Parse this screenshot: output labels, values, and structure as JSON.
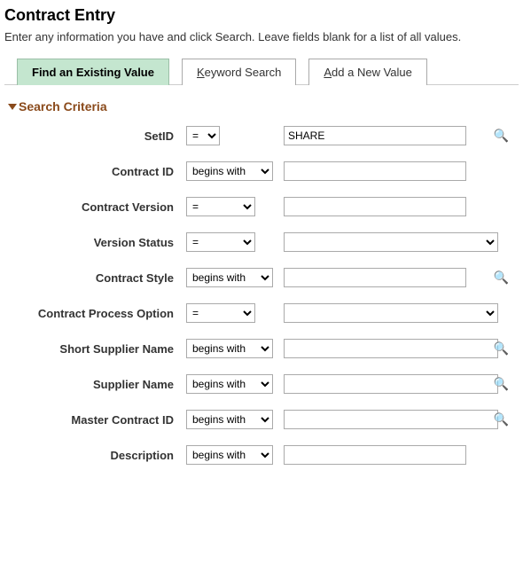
{
  "page": {
    "title": "Contract Entry",
    "subtitle": "Enter any information you have and click Search. Leave fields blank for a list of all values."
  },
  "tabs": {
    "find": "Find an Existing Value",
    "keyword_pre": "K",
    "keyword_rest": "eyword Search",
    "add_pre": "A",
    "add_rest": "dd a New Value"
  },
  "section": {
    "search_criteria": "Search Criteria"
  },
  "ops": {
    "eq": "=",
    "bw": "begins with"
  },
  "rows": {
    "setid": {
      "label": "SetID",
      "value": "SHARE"
    },
    "cid": {
      "label": "Contract ID",
      "value": ""
    },
    "cver": {
      "label": "Contract Version",
      "value": ""
    },
    "vstat": {
      "label": "Version Status",
      "value": ""
    },
    "cstyle": {
      "label": "Contract Style",
      "value": ""
    },
    "cproc": {
      "label": "Contract Process Option",
      "value": ""
    },
    "ssup": {
      "label": "Short Supplier Name",
      "value": ""
    },
    "sup": {
      "label": "Supplier Name",
      "value": ""
    },
    "mcid": {
      "label": "Master Contract ID",
      "value": ""
    },
    "desc": {
      "label": "Description",
      "value": ""
    }
  }
}
